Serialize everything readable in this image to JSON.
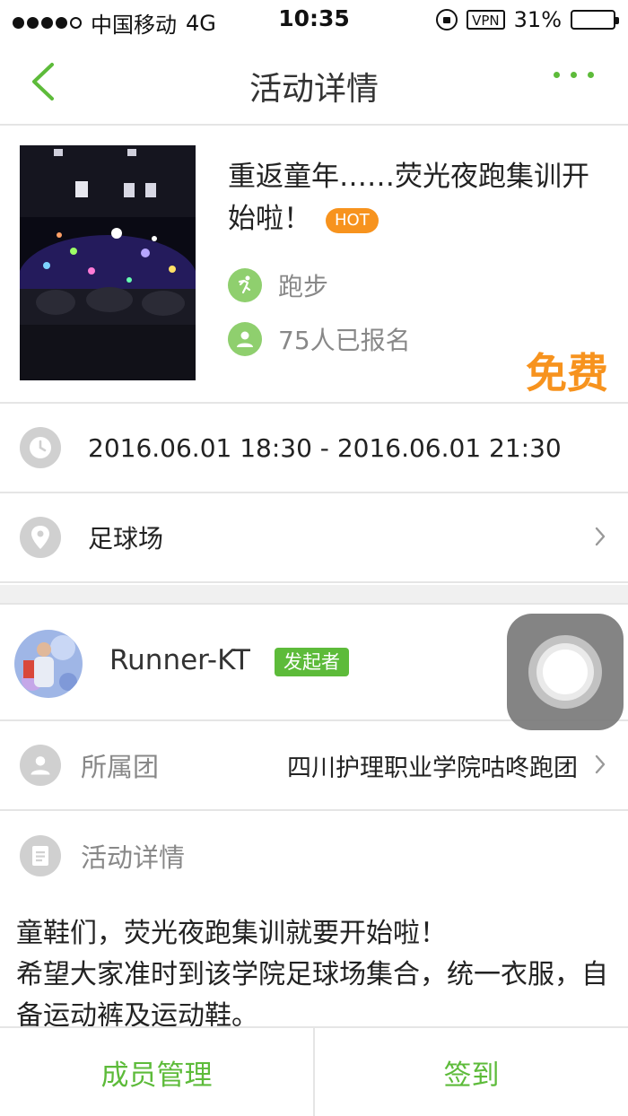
{
  "status_bar": {
    "carrier": "中国移动",
    "network": "4G",
    "time": "10:35",
    "vpn": "VPN",
    "battery": "31%",
    "battery_level": 0.31,
    "battery_color": "#f2c81d"
  },
  "nav": {
    "title": "活动详情",
    "back_icon": "chevron-left-icon",
    "more_icon": "more-dots-icon"
  },
  "activity": {
    "title": "重返童年……荧光夜跑集训开始啦！",
    "hot_badge": "HOT",
    "category": "跑步",
    "signups": "75人已报名",
    "price": "免费"
  },
  "info": {
    "time_range": "2016.06.01 18:30 - 2016.06.01 21:30",
    "location": "足球场"
  },
  "organizer": {
    "name": "Runner-KT",
    "role_badge": "发起者"
  },
  "club": {
    "label": "所属团",
    "value": "四川护理职业学院咕咚跑团"
  },
  "details": {
    "label": "活动详情",
    "line1": "童鞋们，荧光夜跑集训就要开始啦！",
    "line2": "希望大家准时到该学院足球场集合，统一衣服，自备运动裤及运动鞋。"
  },
  "bottom": {
    "members_button": "成员管理",
    "checkin_button": "签到"
  },
  "colors": {
    "accent_green": "#5dbb3a",
    "accent_orange": "#f7931e"
  }
}
